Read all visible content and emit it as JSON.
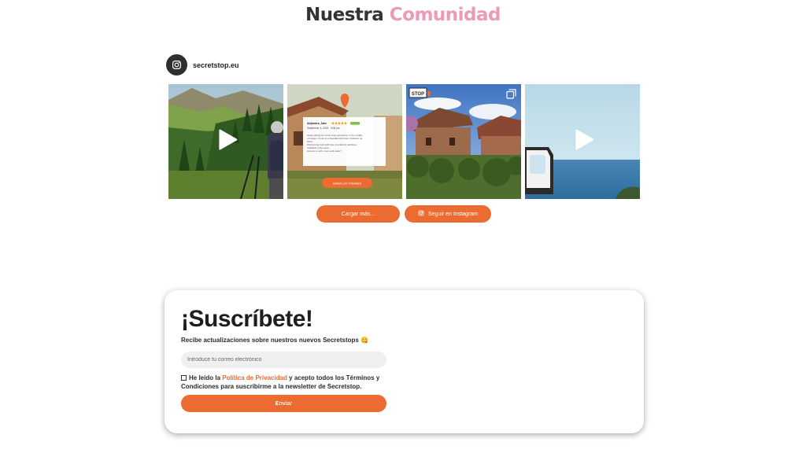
{
  "heading": {
    "part1": "Nuestra",
    "part2": "Comunidad"
  },
  "profile": {
    "handle": "secretstop.eu",
    "icon": "instagram-icon"
  },
  "feed": {
    "tiles": [
      {
        "type": "video",
        "icon": "play-icon"
      },
      {
        "type": "image",
        "review": {
          "user": "Alejandra_Jake",
          "date": "September 3, 2023",
          "time": "3:08 pm",
          "text": "Quiet setting for a full rural experience in the middle of nature. Close to a beautiful old town, Robledo de Mora. Welcoming host with lots of outdoors activities available in the area. Access to sink, oven and water!",
          "button": "MARIA LOS TOMANES"
        }
      },
      {
        "type": "carousel",
        "badge": "STOP",
        "icon": "multiple-images-icon"
      },
      {
        "type": "video",
        "icon": "play-icon"
      }
    ]
  },
  "buttons": {
    "load_more": "Cargar más...",
    "follow": "Seguir en Instagram"
  },
  "subscribe": {
    "title": "¡Suscríbete!",
    "subtitle": "Recibe actualizaciones sobre nuestros nuevos Secretstops 😋",
    "email_placeholder": "Introduce tu correo electrónico",
    "consent_pre": "He leído la ",
    "consent_link": "Política de Privacidad",
    "consent_post": " y acepto todos los Términos y Condiciones para suscribirme a la newsletter de Secretstop.",
    "submit": "Enviar"
  },
  "colors": {
    "accent": "#ec6b30",
    "pink": "#ec9ab8"
  }
}
